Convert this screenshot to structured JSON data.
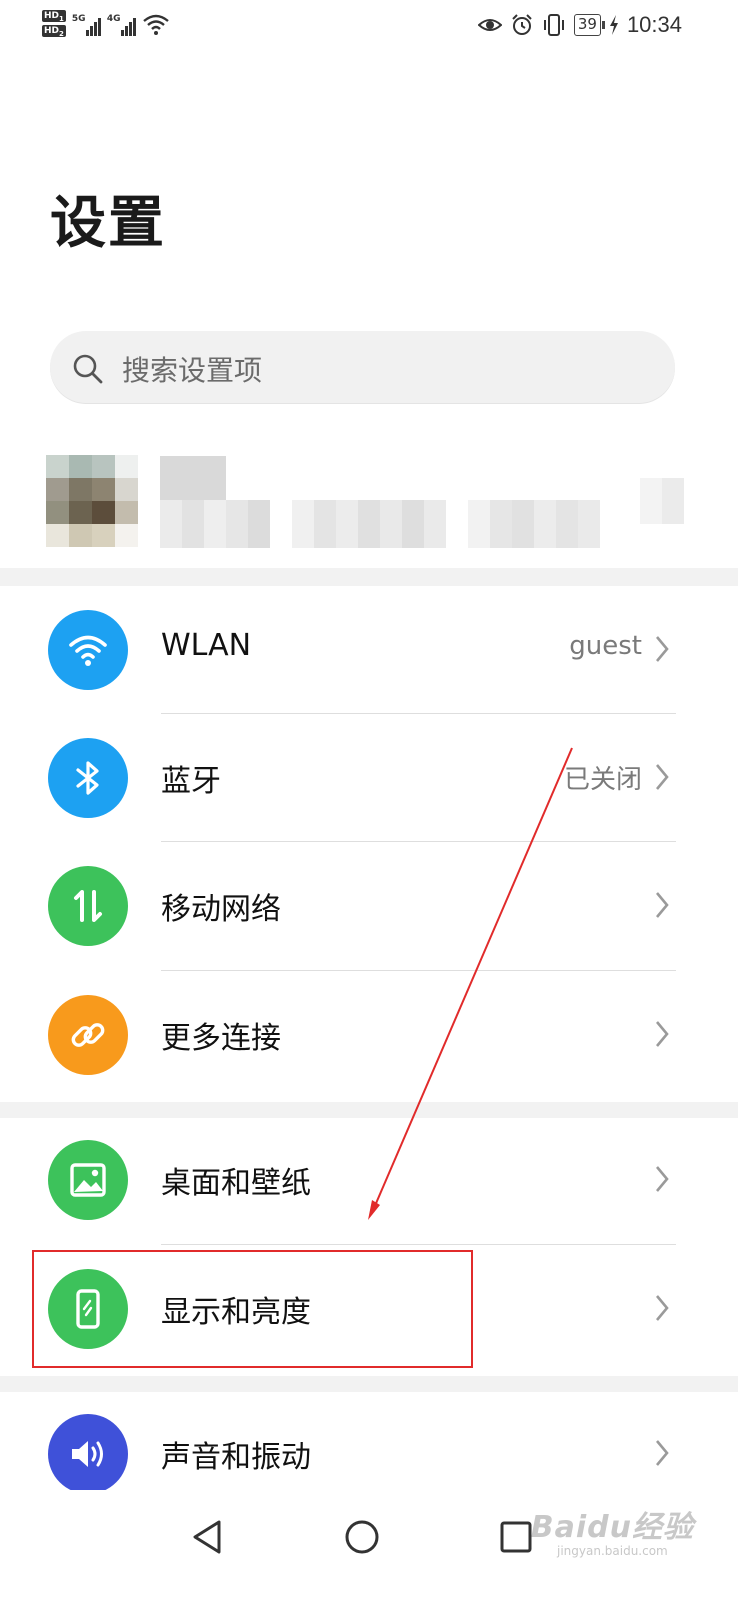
{
  "status_bar": {
    "sim1": "HD",
    "sim1_index": "1",
    "sim2": "HD",
    "sim2_index": "2",
    "net1": "5G",
    "net2": "4G",
    "battery": "39",
    "time": "10:34",
    "icons": [
      "eye-icon",
      "alarm-icon",
      "vibrate-icon",
      "battery-icon",
      "charging-icon"
    ]
  },
  "header": {
    "title": "设置"
  },
  "search": {
    "placeholder": "搜索设置项"
  },
  "settings": [
    {
      "id": "wlan",
      "label": "WLAN",
      "value": "guest",
      "icon": "wifi-icon",
      "color": "#1da1f2"
    },
    {
      "id": "bluetooth",
      "label": "蓝牙",
      "value": "已关闭",
      "icon": "bluetooth-icon",
      "color": "#1da1f2"
    },
    {
      "id": "mobile-network",
      "label": "移动网络",
      "value": "",
      "icon": "data-transfer-icon",
      "color": "#3dc25b"
    },
    {
      "id": "more-connections",
      "label": "更多连接",
      "value": "",
      "icon": "link-icon",
      "color": "#f89a1c"
    },
    {
      "id": "home-wallpaper",
      "label": "桌面和壁纸",
      "value": "",
      "icon": "image-icon",
      "color": "#3dc25b"
    },
    {
      "id": "display-brightness",
      "label": "显示和亮度",
      "value": "",
      "icon": "phone-brightness-icon",
      "color": "#3dc25b"
    },
    {
      "id": "sound-vibration",
      "label": "声音和振动",
      "value": "",
      "icon": "speaker-icon",
      "color": "#3f51d9"
    }
  ],
  "annotation": {
    "highlighted_item": "显示和亮度",
    "color": "#e12b2b"
  },
  "navbar": {
    "buttons": [
      "back-icon",
      "home-icon",
      "recents-icon"
    ]
  },
  "watermark": {
    "main": "Baidu经验",
    "sub": "jingyan.baidu.com"
  }
}
